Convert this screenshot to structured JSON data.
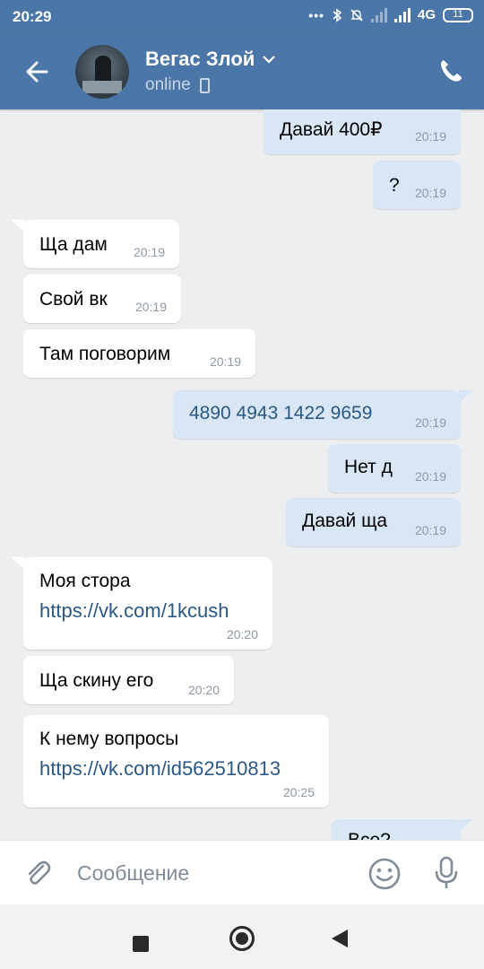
{
  "status_bar": {
    "time": "20:29",
    "network": "4G",
    "battery": "11"
  },
  "header": {
    "contact_name": "Вегас Злой",
    "presence": "online"
  },
  "messages": [
    {
      "dir": "out",
      "text": "Давай 400₽",
      "time": "20:19"
    },
    {
      "dir": "out",
      "text": "?",
      "time": "20:19"
    },
    {
      "dir": "in",
      "text": "Ща дам",
      "time": "20:19"
    },
    {
      "dir": "in",
      "text": "Свой вк",
      "time": "20:19"
    },
    {
      "dir": "in",
      "text": "Там поговорим",
      "time": "20:19"
    },
    {
      "dir": "out",
      "text": "4890 4943 1422 9659",
      "time": "20:19"
    },
    {
      "dir": "out",
      "text": "Нет д",
      "time": "20:19"
    },
    {
      "dir": "out",
      "text": "Давай ща",
      "time": "20:19"
    },
    {
      "dir": "in",
      "text": "Моя стора",
      "link": "https://vk.com/1kcush",
      "time": "20:20"
    },
    {
      "dir": "in",
      "text": "Ща скину его",
      "time": "20:20"
    },
    {
      "dir": "in",
      "text": "К нему вопросы",
      "link": "https://vk.com/id562510813",
      "time": "20:25"
    },
    {
      "dir": "out",
      "text": "Все?",
      "time": ""
    }
  ],
  "composer": {
    "placeholder": "Сообщение"
  },
  "icons": {
    "back": "arrow-left-icon",
    "call": "phone-icon",
    "attach": "paperclip-icon",
    "emoji": "smile-icon",
    "voice": "microphone-icon",
    "dropdown": "chevron-down-icon",
    "device": "mobile-device-icon"
  },
  "colors": {
    "header_bg": "#4a76a8",
    "chat_bg": "#edeef0",
    "outgoing_bubble": "#d8e6f6",
    "incoming_bubble": "#ffffff",
    "link": "#2a5885",
    "time": "#8e98a3"
  }
}
